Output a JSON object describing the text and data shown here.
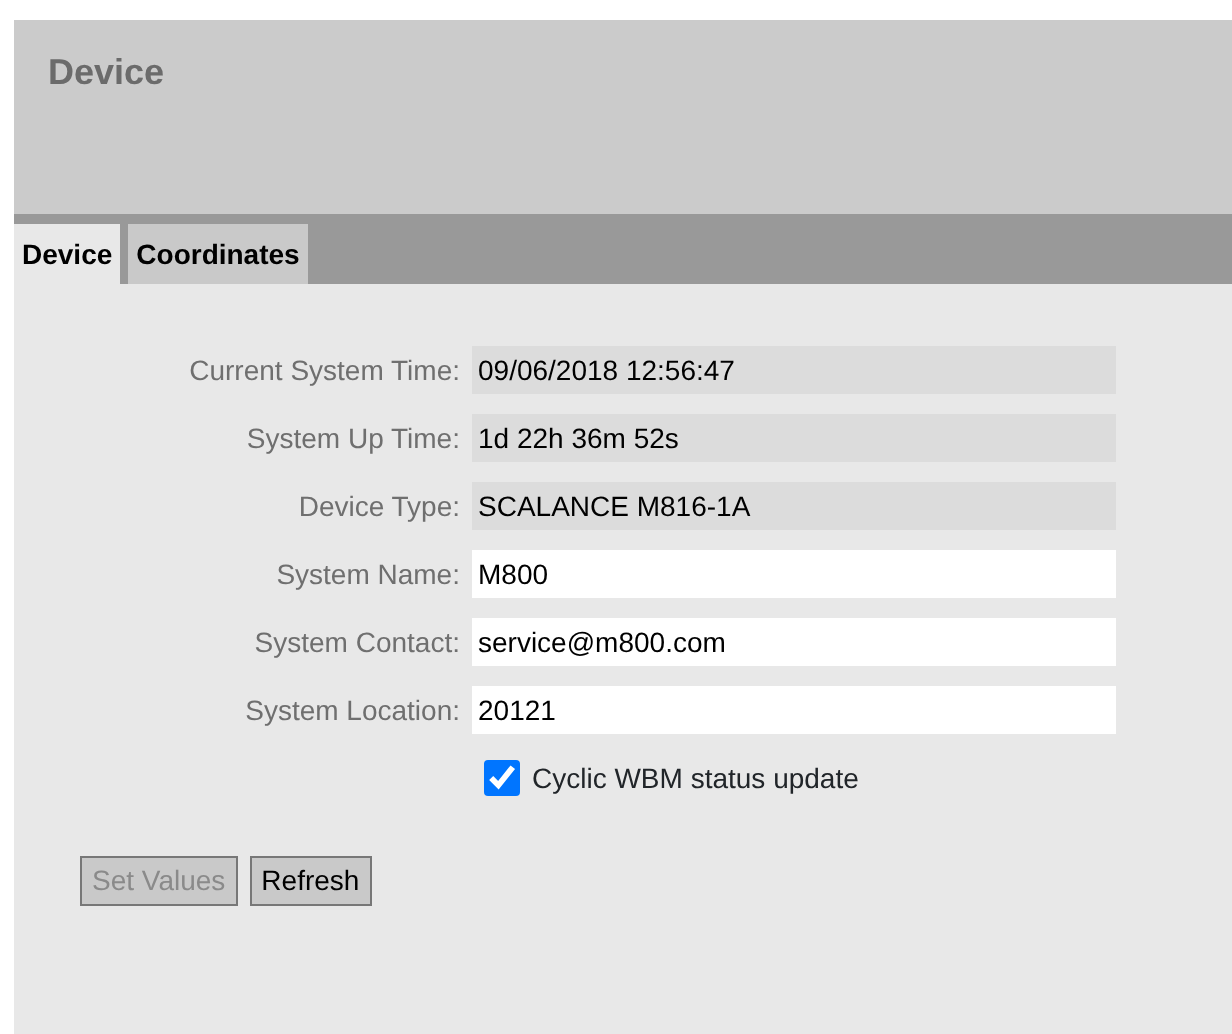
{
  "header": {
    "title": "Device"
  },
  "tabs": [
    {
      "label": "Device",
      "selected": true
    },
    {
      "label": "Coordinates",
      "selected": false
    }
  ],
  "fields": [
    {
      "label": "Current System Time:",
      "value": "09/06/2018 12:56:47",
      "kind": "readonly"
    },
    {
      "label": "System Up Time:",
      "value": "1d 22h 36m 52s",
      "kind": "readonly"
    },
    {
      "label": "Device Type:",
      "value": "SCALANCE M816-1A",
      "kind": "readonly"
    },
    {
      "label": "System Name:",
      "value": "M800",
      "kind": "input"
    },
    {
      "label": "System Contact:",
      "value": "service@m800.com",
      "kind": "input"
    },
    {
      "label": "System Location:",
      "value": "20121",
      "kind": "input"
    }
  ],
  "checkbox": {
    "label": "Cyclic WBM status update",
    "checked": true
  },
  "buttons": [
    {
      "label": "Set Values",
      "disabled": true
    },
    {
      "label": "Refresh",
      "disabled": false
    }
  ]
}
